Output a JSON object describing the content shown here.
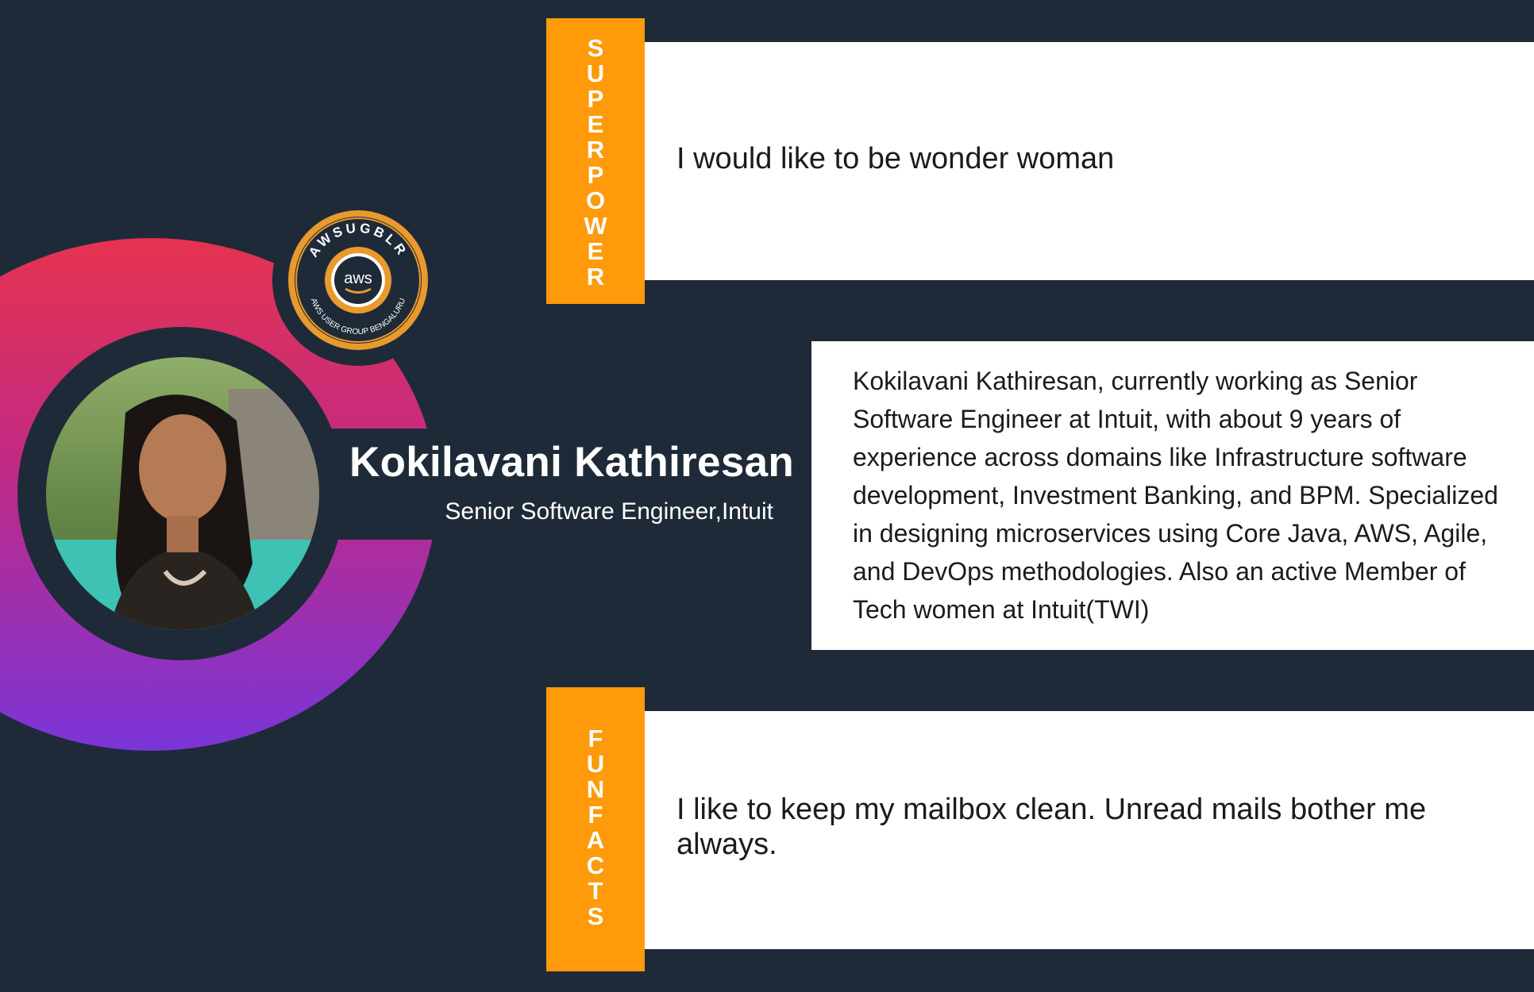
{
  "profile": {
    "name": "Kokilavani Kathiresan",
    "title": "Senior Software Engineer,Intuit"
  },
  "badge": {
    "top_text": "AWSUGBLR",
    "bottom_text": "AWS USER GROUP BENGALURU",
    "logo_text": "aws"
  },
  "superpower": {
    "label_letters": [
      "S",
      "U",
      "P",
      "E",
      "R",
      "P",
      "O",
      "W",
      "E",
      "R"
    ],
    "text": "I would like to be wonder woman"
  },
  "bio": {
    "text": "Kokilavani Kathiresan, currently working as Senior Software Engineer at Intuit, with about 9 years of experience across domains like Infrastructure software development, Investment Banking, and BPM. Specialized in designing microservices using Core Java, AWS, Agile, and DevOps methodologies. Also an active Member of Tech women at Intuit(TWI)"
  },
  "funfacts": {
    "label_letters": [
      "F",
      "U",
      "N",
      "F",
      "A",
      "C",
      "T",
      "S"
    ],
    "text": "I like to keep my mailbox clean. Unread mails bother me always."
  },
  "colors": {
    "background": "#1f2a39",
    "accent_orange": "#ff9a0b",
    "panel": "#ffffff",
    "gradient_top": "#e6334f",
    "gradient_bottom": "#7a35d8"
  }
}
